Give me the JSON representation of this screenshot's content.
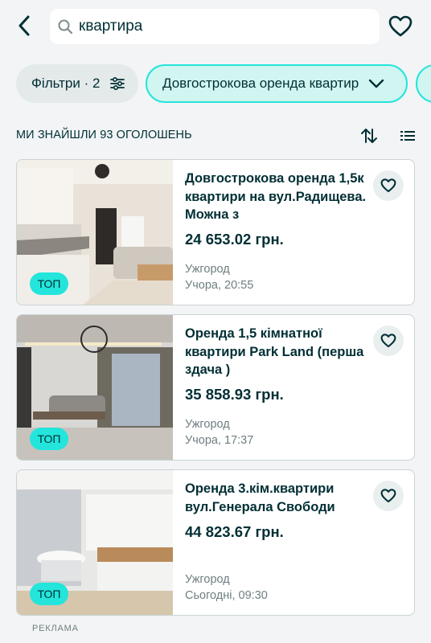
{
  "header": {
    "search_value": "квартира",
    "back_icon": "chevron-left-icon",
    "favorite_icon": "heart-outline-icon"
  },
  "filters": {
    "filters_chip": "Фільтри · 2",
    "category_chip": "Довгострокова оренда квартир"
  },
  "results": {
    "count_text": "МИ ЗНАЙШЛИ 93 ОГОЛОШЕНЬ",
    "sort_icon": "sort-arrows-icon",
    "view_icon": "list-view-icon"
  },
  "listings": [
    {
      "title": "Довгострокова оренда 1,5к квартири на вул.Радищева. Можна з",
      "price": "24 653.02 грн.",
      "city": "Ужгород",
      "date": "Учора, 20:55",
      "badge": "ТОП"
    },
    {
      "title": "Оренда 1,5 кімнатної квартири Park Land (перша здача )",
      "price": "35 858.93 грн.",
      "city": "Ужгород",
      "date": "Учора, 17:37",
      "badge": "ТОП"
    },
    {
      "title": "Оренда 3.кім.квартири вул.Генерала Свободи",
      "price": "44 823.67 грн.",
      "city": "Ужгород",
      "date": "Сьогодні, 09:30",
      "badge": "ТОП"
    }
  ],
  "footer": {
    "ad_label": "РЕКЛАМА"
  },
  "colors": {
    "accent": "#23e5db",
    "text": "#002f34",
    "muted": "#6e7e80",
    "background": "#f2f4f5"
  }
}
